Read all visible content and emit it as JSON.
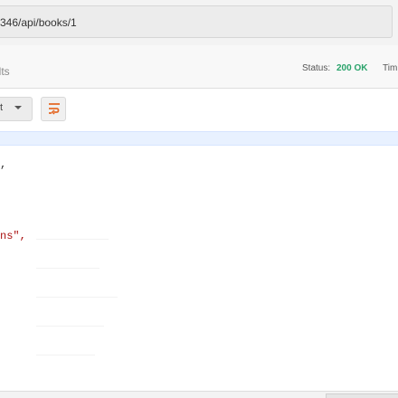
{
  "url_bar": {
    "value": "346/api/books/1"
  },
  "response_meta": {
    "tab_label": "ults",
    "status_label": "Status:",
    "status_value": "200 OK",
    "time_label": "Tim",
    "status_color": "#2aa36b"
  },
  "toolbar": {
    "format_select_visible": "t",
    "wrap_icon_color": "#e46b2a"
  },
  "editor": {
    "lines": [
      {
        "text": ","
      },
      {
        "text": "ns\","
      }
    ]
  }
}
